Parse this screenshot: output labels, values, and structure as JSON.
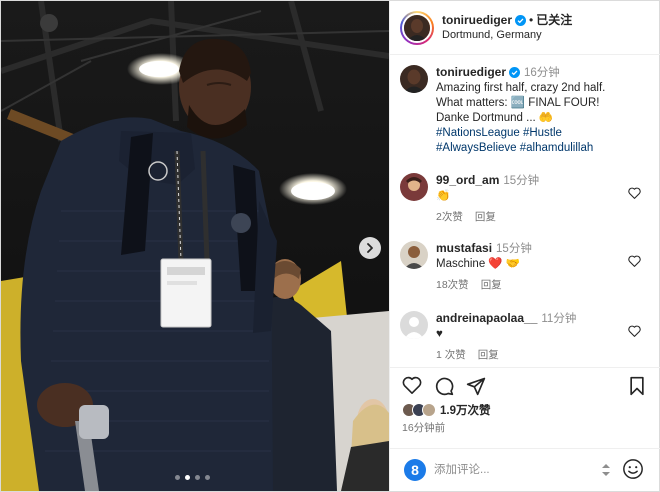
{
  "post_header": {
    "username": "toniruediger",
    "separator": "•",
    "follow_label": "已关注",
    "location": "Dortmund, Germany"
  },
  "caption": {
    "username": "toniruediger",
    "time": "16分钟",
    "line1": "Amazing first half, crazy 2nd half.",
    "line2_pre": "What matters: ",
    "line2_emoji": "🆒",
    "line2_post": " FINAL FOUR!",
    "line3": "Danke Dortmund ... 🤲",
    "hashtags_line1": "#NationsLeague #Hustle",
    "hashtags_line2": "#AlwaysBelieve #alhamdulillah"
  },
  "comments": [
    {
      "username": "99_ord_am",
      "time": "15分钟",
      "text": "👏",
      "likes": "2次赞",
      "reply": "回复"
    },
    {
      "username": "mustafasi",
      "time": "15分钟",
      "text": "Maschine ❤️ 🤝",
      "likes": "18次赞",
      "reply": "回复"
    },
    {
      "username": "andreinapaolaa__",
      "time": "11分钟",
      "text": "♥",
      "likes": "1 次赞",
      "reply": "回复"
    }
  ],
  "actions": {
    "likes_count": "1.9万次赞",
    "posted_time": "16分钟前"
  },
  "add_comment": {
    "placeholder": "添加评论..."
  },
  "carousel": {
    "slide_count": 4,
    "active_index": 1
  },
  "colors": {
    "hashtag": "#00376b",
    "verified": "#0095f6",
    "heart": "#ed4956",
    "muted": "#737373"
  }
}
